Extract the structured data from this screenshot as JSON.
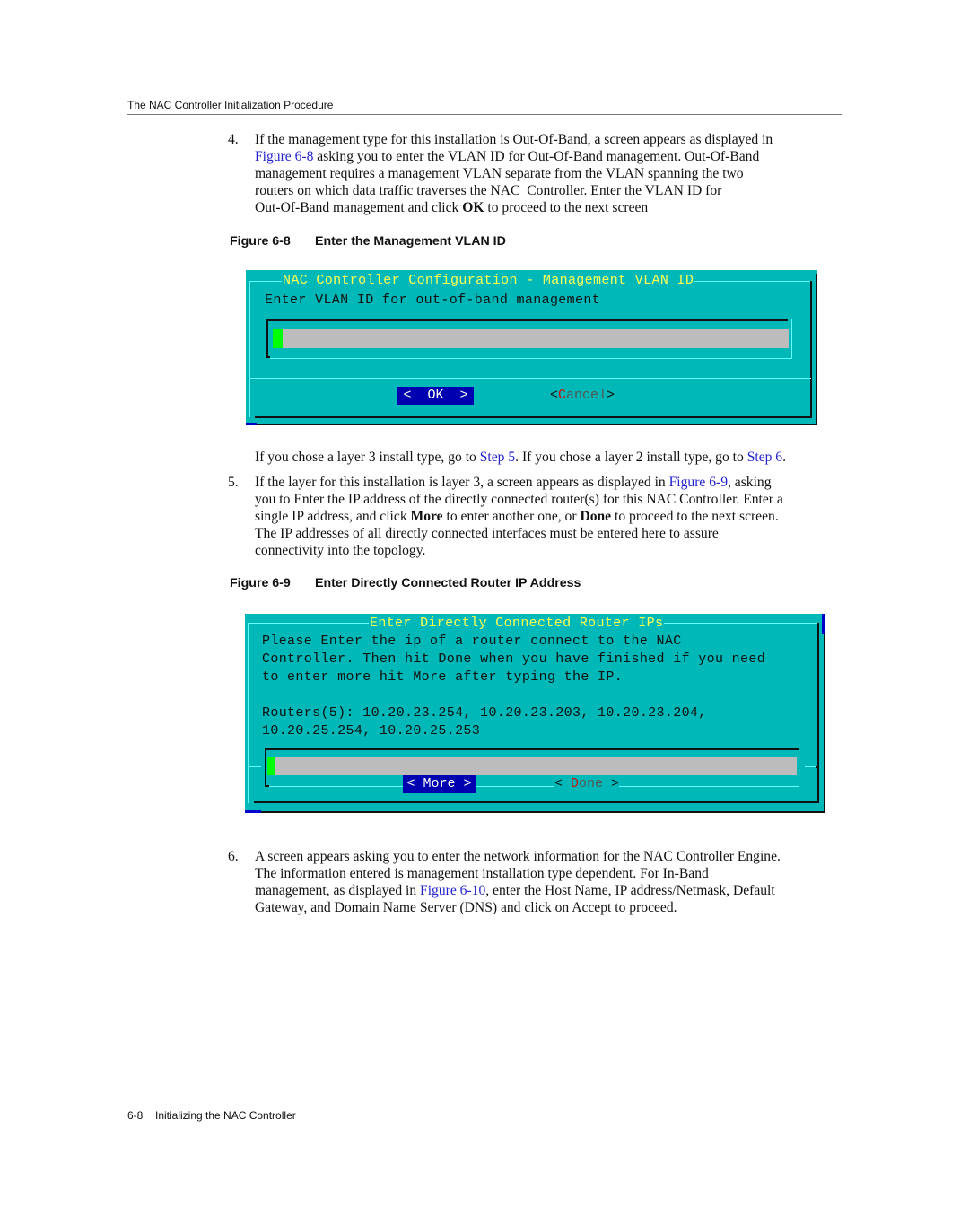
{
  "header": {
    "running_title": "The NAC Controller Initialization Procedure"
  },
  "step4": {
    "number": "4.",
    "text_1": "If the management type for this installation is Out-Of-Band, a screen appears as displayed in",
    "link_figure": "Figure 6-8",
    "text_2": " asking you to enter the VLAN ID for Out-Of-Band management. Out-Of-Band",
    "text_3": "management requires a management VLAN separate from the VLAN spanning the two",
    "text_4": "routers on which data traffic traverses the NAC  Controller. Enter the VLAN ID for",
    "text_5a": "Out-Of-Band management and click ",
    "text_5b": "OK",
    "text_5c": " to proceed to the next screen"
  },
  "figure8": {
    "number": "Figure 6-8",
    "caption": "Enter the Management VLAN ID",
    "dialog": {
      "title": "NAC Controller Configuration - Management VLAN ID",
      "prompt": "Enter VLAN ID for out-of-band management",
      "input_value": "",
      "ok_button": "<  OK  >",
      "cancel_open": "<",
      "cancel_hot": "C",
      "cancel_rest": "ancel",
      "cancel_close": ">"
    }
  },
  "step4_note": {
    "text_1": "If you chose a layer 3 install type, go to ",
    "link_step5": "Step 5",
    "text_2": ". If you chose a layer 2 install type, go to ",
    "link_step6": "Step 6",
    "text_3": "."
  },
  "step5": {
    "number": "5.",
    "text_1a": "If the layer for this installation is layer 3, a screen appears as displayed in ",
    "link_figure": "Figure 6-9",
    "text_1b": ", asking",
    "text_2": "you to Enter the IP address of the directly connected router(s) for this NAC Controller. Enter a",
    "text_3a": "single IP address, and click ",
    "text_3b": "More",
    "text_3c": " to enter another one, or ",
    "text_3d": "Done",
    "text_3e": " to proceed to the next screen.",
    "text_4": "The IP addresses of all directly connected interfaces must be entered here to assure",
    "text_5": "connectivity into the topology."
  },
  "figure9": {
    "number": "Figure 6-9",
    "caption": "Enter Directly Connected Router IP Address",
    "dialog": {
      "title": "Enter Directly Connected Router IPs",
      "message_lines": [
        "Please Enter the ip of a router connect to the NAC",
        "Controller. Then hit Done when you have finished if you need",
        "to enter more hit More after typing the IP."
      ],
      "routers_lines": [
        "Routers(5): 10.20.23.254, 10.20.23.203, 10.20.23.204,",
        "10.20.25.254, 10.20.25.253"
      ],
      "input_value": "",
      "more_button": "< More >",
      "done_open": "< ",
      "done_hot": "D",
      "done_rest": "one",
      "done_close": " >"
    }
  },
  "step6": {
    "number": "6.",
    "text_1": "A screen appears asking you to enter the network information for the NAC Controller Engine.",
    "text_2": "The information entered is management installation type dependent. For In-Band",
    "text_3a": "management, as displayed in ",
    "link_figure": "Figure 6-10",
    "text_3b": ", enter the Host Name, IP address/Netmask, Default",
    "text_4": "Gateway, and Domain Name Server (DNS) and click on Accept to proceed."
  },
  "footer": {
    "page_number": "6-8",
    "section_title": "Initializing the NAC Controller"
  }
}
